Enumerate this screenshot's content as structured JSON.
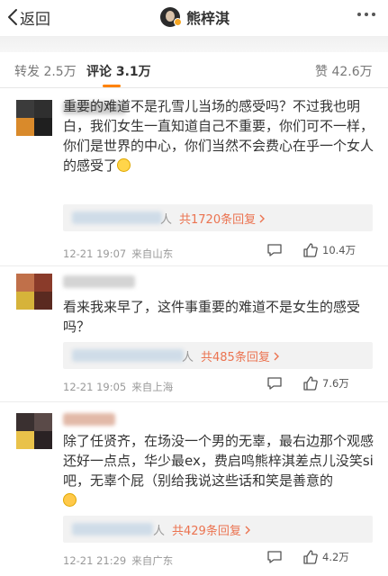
{
  "header": {
    "back_label": "返回",
    "title": "熊梓淇"
  },
  "tabs": [
    {
      "label": "转发 2.5万"
    },
    {
      "label": "评论 3.1万"
    },
    {
      "label": "赞 42.6万"
    }
  ],
  "comments": [
    {
      "text": "重要的难道不是孔雪儿当场的感受吗？不过我也明白，我们女生一直知道自己不重要，你们可不一样，你们是世界的中心，你们当然不会费心在乎一个女人的感受了",
      "replies": {
        "person": "人",
        "link": "共1720条回复"
      },
      "time": "12-21 19:07",
      "location": "来自山东",
      "likes": "10.4万"
    },
    {
      "text": "看来我来早了，这件事重要的难道不是女生的感受吗？",
      "replies": {
        "person": "人",
        "link": "共485条回复"
      },
      "time": "12-21 19:05",
      "location": "来自上海",
      "likes": "7.6万"
    },
    {
      "text": "除了任贤齐，在场没一个男的无辜，最右边那个观感还好一点点，华少最ex，费启鸣熊梓淇差点儿没笑si吧，无辜个屁（别给我说这些话和笑是善意的",
      "replies": {
        "person": "人",
        "link": "共429条回复"
      },
      "time": "12-21 21:29",
      "location": "来自广东",
      "likes": "4.2万"
    }
  ],
  "icon_color": "#555555",
  "link_color": "#eb7350",
  "tab_accent": "#ff8200"
}
